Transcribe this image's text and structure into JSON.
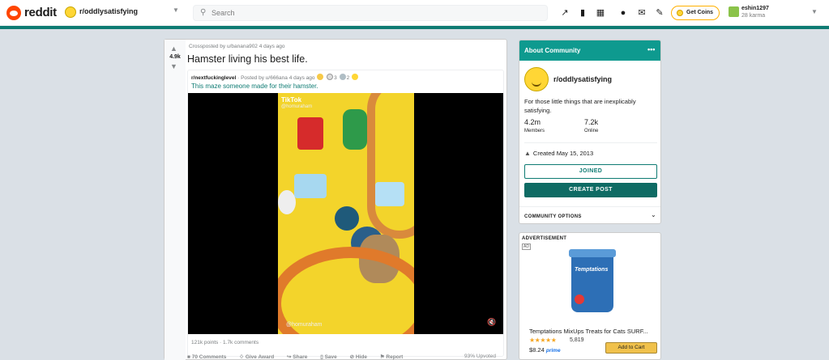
{
  "header": {
    "logo_text": "reddit",
    "subreddit": "r/oddlysatisfying",
    "search_placeholder": "Search",
    "coins_label": "Get Coins",
    "username": "eshin1297",
    "karma": "28 karma",
    "icons": [
      "trending-icon",
      "chart-icon",
      "qr-icon",
      "chat-icon",
      "mail-icon",
      "pencil-icon"
    ]
  },
  "post": {
    "score": "4.9k",
    "crosspost": "Crossposted by u/banana902 4 days ago",
    "title": "Hamster living his best life.",
    "original": {
      "subreddit": "r/nextfuckinglevel",
      "posted": "· Posted by u/666ana 4 days ago",
      "award_counts": [
        "3",
        "2"
      ],
      "caption": "This maze someone made for their hamster.",
      "stats": "121k points · 1.7k comments"
    },
    "video": {
      "watermark": "TikTok",
      "handle_top": "@homuraham",
      "handle_bottom": "@homuraham"
    },
    "actions": {
      "comments": "70 Comments",
      "award": "Give Award",
      "share": "Share",
      "save": "Save",
      "hide": "Hide",
      "report": "Report"
    },
    "upvoted": "93% Upvoted"
  },
  "about": {
    "heading": "About Community",
    "name": "r/oddlysatisfying",
    "description": "For those little things that are inexplicably satisfying.",
    "members_value": "4.2m",
    "members_label": "Members",
    "online_value": "7.2k",
    "online_label": "Online",
    "created": "Created May 15, 2013",
    "joined_label": "JOINED",
    "create_label": "CREATE POST",
    "options_label": "COMMUNITY OPTIONS"
  },
  "ad": {
    "label": "ADVERTISEMENT",
    "tag": "AD",
    "brand": "Temptations",
    "product_title": "Temptations MixUps Treats for Cats SURF...",
    "rating_count": "5,819",
    "price": "$8.24",
    "prime": "prime",
    "cart_label": "Add to Cart"
  },
  "colors": {
    "accent": "#0e7b73",
    "brand": "#ff4500"
  }
}
